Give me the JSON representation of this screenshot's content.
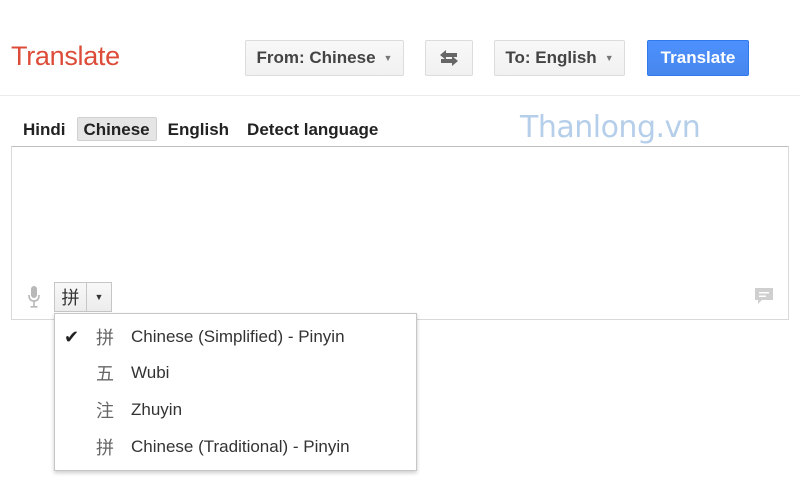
{
  "header": {
    "title": "Translate",
    "from_label": "From: Chinese",
    "swap_icon": "swap-arrows-icon",
    "to_label": "To: English",
    "translate_label": "Translate"
  },
  "source_languages": [
    "Hindi",
    "Chinese",
    "English",
    "Detect language"
  ],
  "selected_source": "Chinese",
  "watermark": "Thanlong.vn",
  "input": {
    "value": "",
    "ime_glyph": "拼",
    "icons": [
      "microphone-icon",
      "feedback-icon"
    ]
  },
  "ime_menu": {
    "items": [
      {
        "glyph": "拼",
        "label": "Chinese (Simplified) - Pinyin",
        "checked": true
      },
      {
        "glyph": "五",
        "label": "Wubi",
        "checked": false
      },
      {
        "glyph": "注",
        "label": "Zhuyin",
        "checked": false
      },
      {
        "glyph": "拼",
        "label": "Chinese (Traditional) - Pinyin",
        "checked": false
      }
    ]
  },
  "colors": {
    "title_red": "#dd4b39",
    "primary_blue": "#4d90fe",
    "watermark_blue": "#a9c6e6"
  }
}
